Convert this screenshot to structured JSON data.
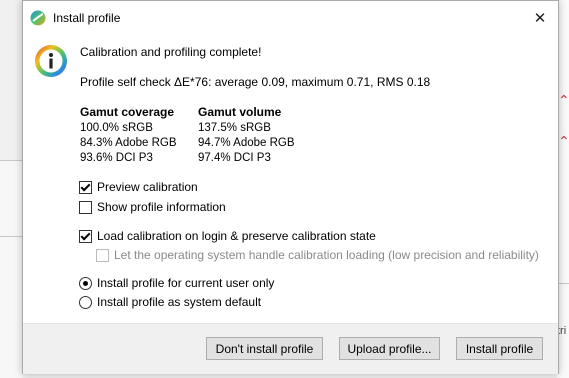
{
  "window": {
    "title": "Install profile"
  },
  "message": {
    "heading": "Calibration and profiling complete!",
    "self_check": "Profile self check ΔE*76: average 0.09, maximum 0.71, RMS 0.18"
  },
  "gamut_coverage": {
    "header": "Gamut coverage",
    "rows": [
      "100.0% sRGB",
      "84.3% Adobe RGB",
      "93.6% DCI P3"
    ]
  },
  "gamut_volume": {
    "header": "Gamut volume",
    "rows": [
      "137.5% sRGB",
      "94.7% Adobe RGB",
      "97.4% DCI P3"
    ]
  },
  "options": {
    "preview_calibration": {
      "label": "Preview calibration",
      "checked": true
    },
    "show_profile_info": {
      "label": "Show profile information",
      "checked": false
    },
    "load_calibration": {
      "label": "Load calibration on login & preserve calibration state",
      "checked": true
    },
    "os_handle_loading": {
      "label": "Let the operating system handle calibration loading (low precision and reliability)",
      "checked": false,
      "disabled": true
    }
  },
  "install_scope": {
    "current_user": {
      "label": "Install profile for current user only",
      "selected": true
    },
    "system_default": {
      "label": "Install profile as system default",
      "selected": false
    }
  },
  "buttons": {
    "dont_install": "Don't install profile",
    "upload": "Upload profile...",
    "install": "Install profile"
  },
  "background": {
    "partial_text": "tri"
  },
  "colors": {
    "accent_red": "#d04040"
  }
}
